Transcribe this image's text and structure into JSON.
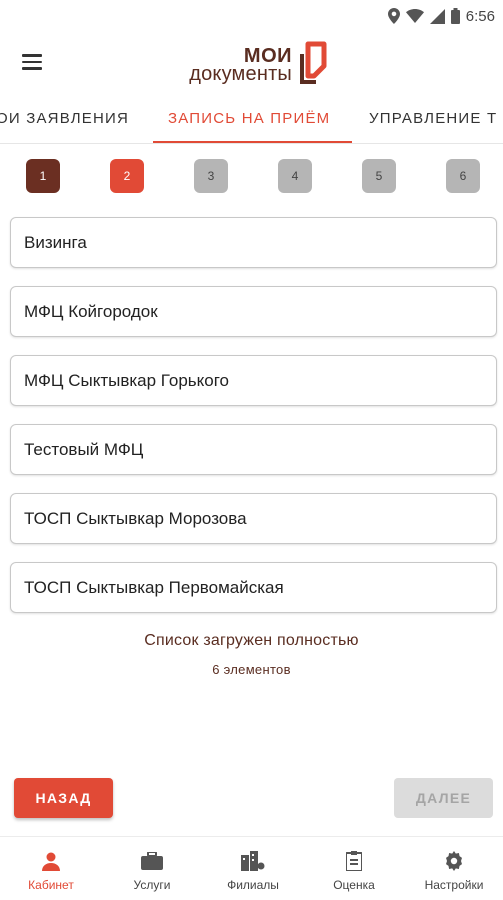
{
  "status_bar": {
    "time": "6:56",
    "icons": [
      "location-icon",
      "wifi-icon",
      "signal-icon",
      "battery-icon"
    ]
  },
  "app_bar": {
    "menu_icon": "hamburger-menu-icon",
    "logo": {
      "line1": "МОИ",
      "line2": "документы"
    }
  },
  "tabs": [
    {
      "label": "ОИ ЗАЯВЛЕНИЯ",
      "active": false
    },
    {
      "label": "ЗАПИСЬ НА ПРИЁМ",
      "active": true
    },
    {
      "label": "УПРАВЛЕНИЕ Т",
      "active": false
    }
  ],
  "steps": [
    {
      "label": "1",
      "state": "done"
    },
    {
      "label": "2",
      "state": "current"
    },
    {
      "label": "3",
      "state": "todo"
    },
    {
      "label": "4",
      "state": "todo"
    },
    {
      "label": "5",
      "state": "todo"
    },
    {
      "label": "6",
      "state": "todo"
    }
  ],
  "offices": [
    "Визинга",
    "МФЦ Койгородок",
    "МФЦ Сыктывкар Горького",
    "Тестовый МФЦ",
    "ТОСП Сыктывкар Морозова",
    "ТОСП Сыктывкар Первомайская"
  ],
  "list_status": {
    "title": "Список загружен полностью",
    "count": "6 элементов"
  },
  "actions": {
    "back_label": "НАЗАД",
    "next_label": "ДАЛЕЕ",
    "next_enabled": false
  },
  "bottom_nav": [
    {
      "label": "Кабинет",
      "icon": "person-icon",
      "active": true
    },
    {
      "label": "Услуги",
      "icon": "briefcase-icon",
      "active": false
    },
    {
      "label": "Филиалы",
      "icon": "buildings-icon",
      "active": false
    },
    {
      "label": "Оценка",
      "icon": "clipboard-icon",
      "active": false
    },
    {
      "label": "Настройки",
      "icon": "gear-icon",
      "active": false
    }
  ],
  "colors": {
    "accent": "#e14a36",
    "brand_dark": "#5a2d21",
    "step_done": "#6b2f22",
    "step_todo": "#b5b5b5",
    "disabled_button": "#dcdcdc"
  }
}
